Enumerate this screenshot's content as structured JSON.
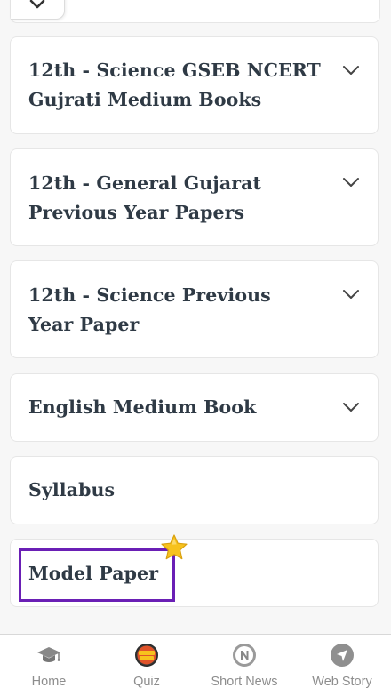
{
  "accordion": {
    "items": [
      {
        "title": "12th - Science GSEB NCERT Gujrati Medium Books",
        "expandable": true
      },
      {
        "title": "12th - General Gujarat Previous Year Papers",
        "expandable": true
      },
      {
        "title": "12th - Science Previous Year Paper",
        "expandable": true
      },
      {
        "title": "English Medium Book",
        "expandable": true
      },
      {
        "title": "Syllabus",
        "expandable": false
      },
      {
        "title": "Model Paper",
        "expandable": false,
        "highlighted": true
      }
    ]
  },
  "bottom_nav": {
    "items": [
      {
        "label": "Home",
        "icon": "graduation-cap-icon"
      },
      {
        "label": "Quiz",
        "icon": "quiz-time-icon"
      },
      {
        "label": "Short News",
        "icon": "news-n-icon"
      },
      {
        "label": "Web Story",
        "icon": "navigation-arrow-icon"
      }
    ]
  },
  "colors": {
    "title_text": "#2f3a45",
    "highlight_border": "#6a1fb5",
    "nav_label": "#8d8d8d",
    "star": "#f7c21d",
    "background": "#f7f7f7"
  }
}
